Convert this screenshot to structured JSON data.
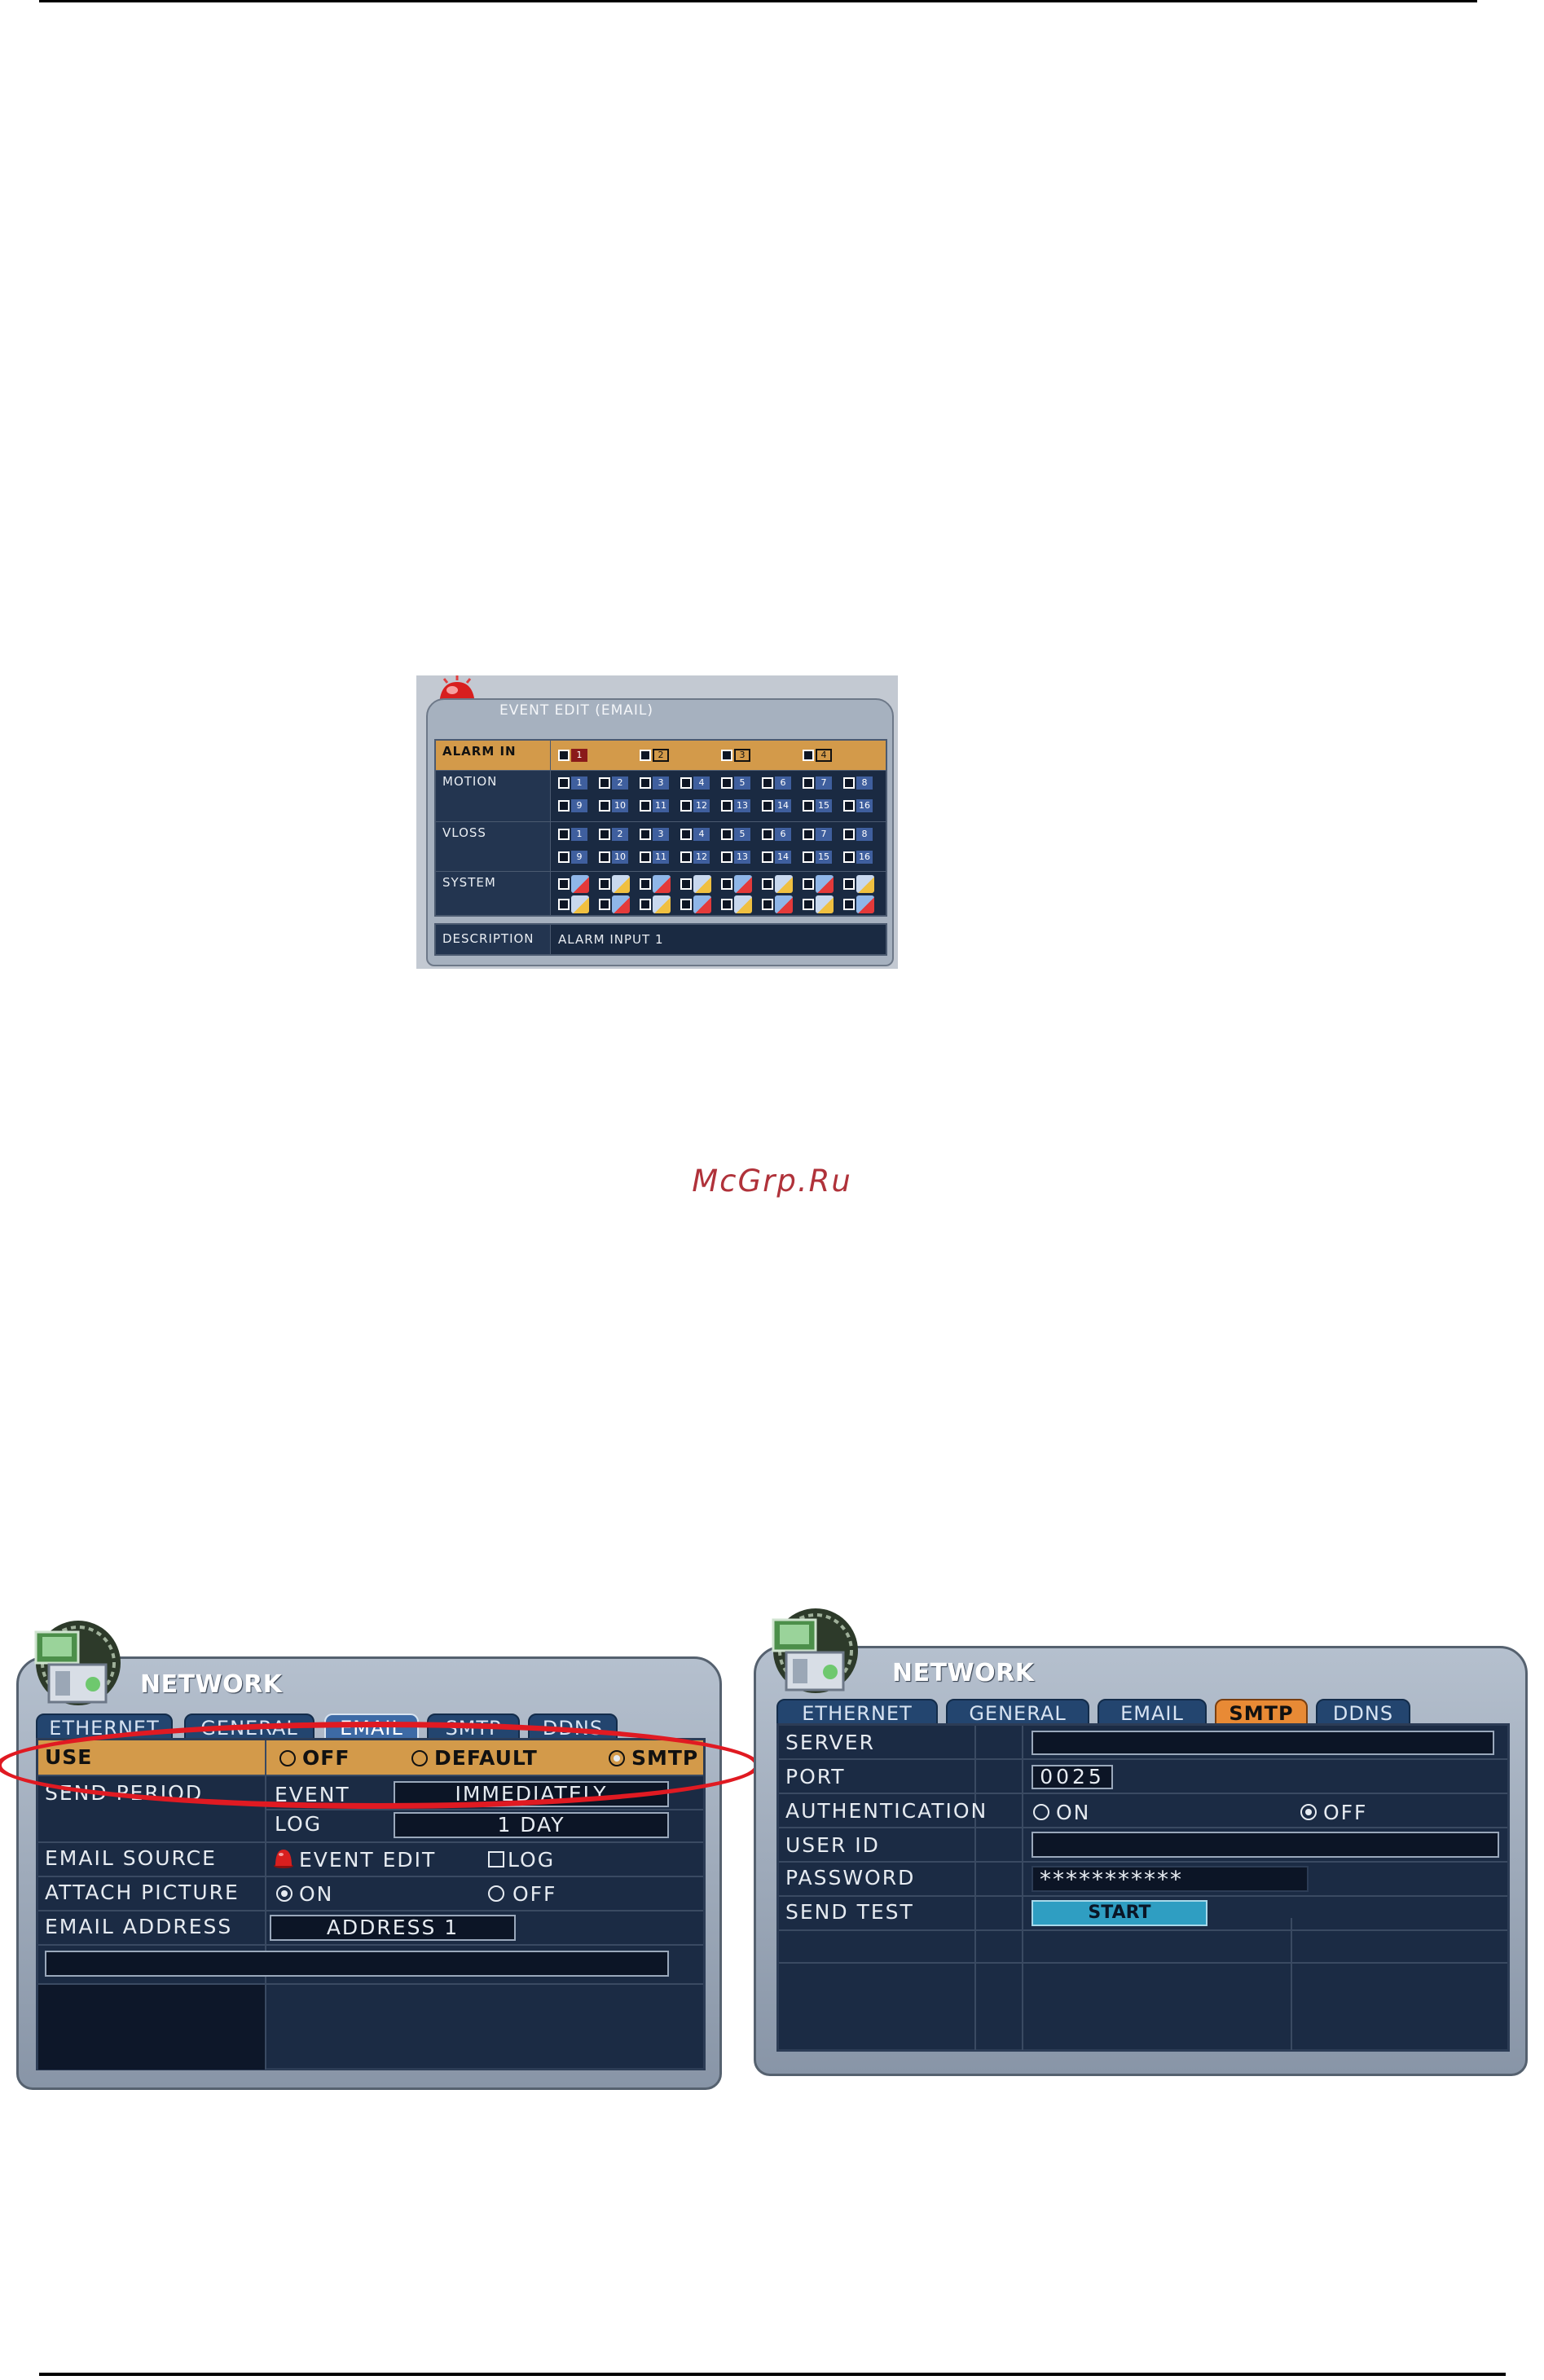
{
  "watermark": "McGrp.Ru",
  "event_edit": {
    "title": "EVENT EDIT (EMAIL)",
    "rows": {
      "alarm_in": "ALARM IN",
      "motion": "MOTION",
      "vloss": "VLOSS",
      "system": "SYSTEM"
    },
    "alarm_numbers": [
      "1",
      "2",
      "3",
      "4"
    ],
    "channel_row1": [
      "1",
      "2",
      "3",
      "4",
      "5",
      "6",
      "7",
      "8"
    ],
    "channel_row2": [
      "9",
      "10",
      "11",
      "12",
      "13",
      "14",
      "15",
      "16"
    ],
    "description_label": "DESCRIPTION",
    "description_value": "ALARM INPUT 1",
    "colors": {
      "alarm_row": "#d39a4a",
      "panel_bg": "#1a2a42",
      "number_chip": "#3f5f9e"
    },
    "icons": [
      "siren-icon",
      "system-event-icon"
    ]
  },
  "network_email": {
    "title": "NETWORK",
    "tabs": [
      "ETHERNET",
      "GENERAL",
      "EMAIL",
      "SMTP",
      "DDNS"
    ],
    "selected_tab": "EMAIL",
    "use_label": "USE",
    "use_options": [
      "OFF",
      "DEFAULT",
      "SMTP"
    ],
    "use_selected": "SMTP",
    "send_period_label": "SEND PERIOD",
    "event_label": "EVENT",
    "event_value": "IMMEDIATELY",
    "log_label": "LOG",
    "log_value": "1 DAY",
    "email_source_label": "EMAIL SOURCE",
    "email_source_event_edit": "EVENT EDIT",
    "email_source_log": "LOG",
    "attach_picture_label": "ATTACH PICTURE",
    "attach_on": "ON",
    "attach_off": "OFF",
    "attach_selected": "ON",
    "email_address_label": "EMAIL ADDRESS",
    "email_address_value": "ADDRESS 1",
    "email_address_field": "",
    "icons": [
      "network-dvr-icon",
      "siren-icon"
    ],
    "highlight_color": "#e01a22"
  },
  "network_smtp": {
    "title": "NETWORK",
    "tabs": [
      "ETHERNET",
      "GENERAL",
      "EMAIL",
      "SMTP",
      "DDNS"
    ],
    "selected_tab": "SMTP",
    "server_label": "SERVER",
    "server_value": "",
    "port_label": "PORT",
    "port_value": "0025",
    "authentication_label": "AUTHENTICATION",
    "auth_on": "ON",
    "auth_off": "OFF",
    "auth_selected": "OFF",
    "user_id_label": "USER ID",
    "user_id_value": "",
    "password_label": "PASSWORD",
    "password_value": "***********",
    "send_test_label": "SEND TEST",
    "start_label": "START",
    "colors": {
      "selected_tab": "#e88a35",
      "start_button": "#2f9ec2"
    },
    "icons": [
      "network-dvr-icon"
    ]
  }
}
